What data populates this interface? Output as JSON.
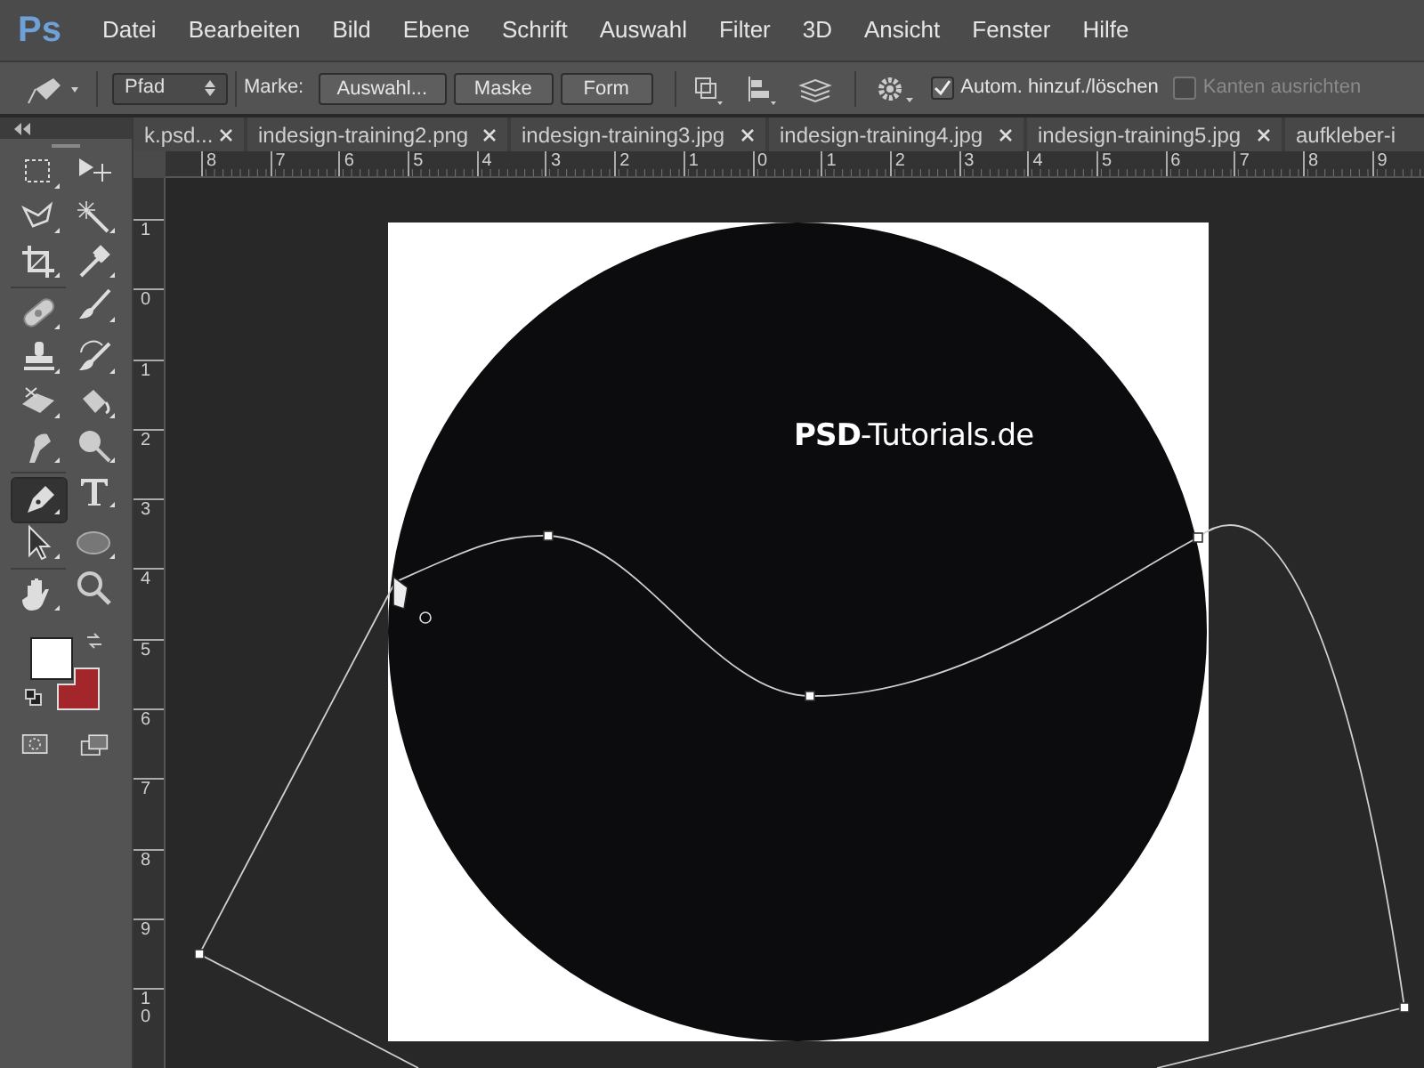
{
  "app_logo": "Ps",
  "menu": [
    "Datei",
    "Bearbeiten",
    "Bild",
    "Ebene",
    "Schrift",
    "Auswahl",
    "Filter",
    "3D",
    "Ansicht",
    "Fenster",
    "Hilfe"
  ],
  "options_bar": {
    "mode": "Pfad",
    "make_label": "Marke:",
    "buttons": [
      "Auswahl...",
      "Maske",
      "Form"
    ],
    "checkboxes": [
      {
        "label": "Autom. hinzuf./löschen",
        "checked": true,
        "disabled": false
      },
      {
        "label": "Kanten ausrichten",
        "checked": false,
        "disabled": true
      }
    ]
  },
  "tabs": [
    {
      "label": "k.psd...",
      "selected": false
    },
    {
      "label": "indesign-training2.png",
      "selected": false
    },
    {
      "label": "indesign-training3.jpg",
      "selected": false
    },
    {
      "label": "indesign-training4.jpg",
      "selected": false
    },
    {
      "label": "indesign-training5.jpg",
      "selected": false
    },
    {
      "label": "aufkleber-i",
      "selected": false
    }
  ],
  "tools": [
    {
      "kind": "marquee",
      "selected": false
    },
    {
      "kind": "move",
      "selected": false
    },
    {
      "kind": "lasso",
      "selected": false
    },
    {
      "kind": "wand",
      "selected": false
    },
    {
      "kind": "crop",
      "selected": false
    },
    {
      "kind": "eyedropper",
      "selected": false
    },
    {
      "kind": "healing",
      "selected": false
    },
    {
      "kind": "brush",
      "selected": false
    },
    {
      "kind": "stamp",
      "selected": false
    },
    {
      "kind": "historybrush",
      "selected": false
    },
    {
      "kind": "eraser",
      "selected": false
    },
    {
      "kind": "bucket",
      "selected": false
    },
    {
      "kind": "smudge",
      "selected": false
    },
    {
      "kind": "dodge",
      "selected": false
    },
    {
      "kind": "pen",
      "selected": true
    },
    {
      "kind": "type",
      "selected": false
    },
    {
      "kind": "pathselect",
      "selected": false
    },
    {
      "kind": "ellipse",
      "selected": false
    },
    {
      "kind": "hand",
      "selected": false
    },
    {
      "kind": "zoom",
      "selected": false
    }
  ],
  "ruler_horizontal": [
    "8",
    "7",
    "6",
    "5",
    "4",
    "3",
    "2",
    "1",
    "0",
    "1",
    "2",
    "3",
    "4",
    "5",
    "6",
    "7",
    "8",
    "9"
  ],
  "ruler_vertical": [
    "1",
    "0",
    "1",
    "2",
    "3",
    "4",
    "5",
    "6",
    "7",
    "8",
    "9",
    "10"
  ],
  "canvas": {
    "watermark_text": "**PSD**-Tutorials.de"
  }
}
